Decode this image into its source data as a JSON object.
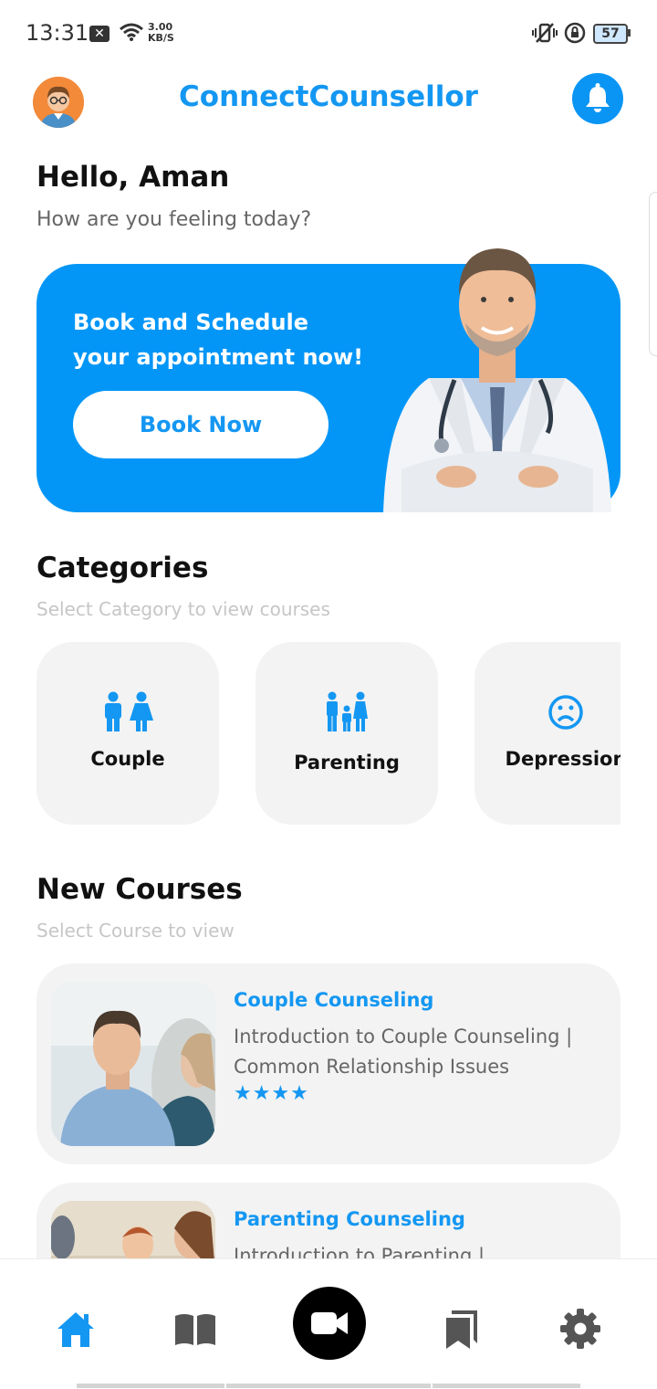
{
  "status_bar": {
    "time": "13:31",
    "speed_value": "3.00",
    "speed_unit": "KB/S",
    "battery": "57"
  },
  "header": {
    "title": "ConnectCounsellor"
  },
  "greeting": {
    "hello": "Hello, Aman",
    "subtitle": "How are you feeling today?"
  },
  "banner": {
    "line1": "Book and Schedule",
    "line2": "your appointment now!",
    "button": "Book Now"
  },
  "categories": {
    "title": "Categories",
    "subtitle": "Select Category to view courses",
    "items": [
      {
        "label": "Couple",
        "icon": "couple-icon"
      },
      {
        "label": "Parenting",
        "icon": "family-icon"
      },
      {
        "label": "Depression",
        "icon": "sad-face-icon"
      }
    ]
  },
  "courses": {
    "title": "New Courses",
    "subtitle": "Select Course to view",
    "items": [
      {
        "title": "Couple Counseling",
        "description": "Introduction to Couple Counseling | Common Relationship Issues",
        "rating": 4,
        "stars": "★★★★"
      },
      {
        "title": "Parenting Counseling",
        "description": "Introduction to Parenting |"
      }
    ]
  },
  "bottom_nav": [
    "home-icon",
    "book-open-icon",
    "video-camera-icon",
    "bookmarks-icon",
    "gear-icon"
  ],
  "colors": {
    "accent": "#1497f2",
    "banner": "#0396f7",
    "card": "#f3f3f3"
  }
}
